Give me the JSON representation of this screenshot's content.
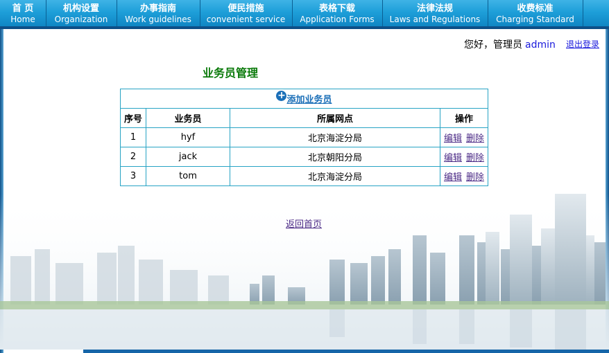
{
  "nav": [
    {
      "zh": "首 页",
      "en": "Home"
    },
    {
      "zh": "机构设置",
      "en": "Organization"
    },
    {
      "zh": "办事指南",
      "en": "Work guidelines"
    },
    {
      "zh": "便民措施",
      "en": "convenient service"
    },
    {
      "zh": "表格下载",
      "en": "Application Forms"
    },
    {
      "zh": "法律法规",
      "en": "Laws and Regulations"
    },
    {
      "zh": "收费标准",
      "en": "Charging Standard"
    }
  ],
  "header": {
    "greeting": "您好，管理员",
    "username": "admin",
    "logout": "退出登录"
  },
  "page_title": "业务员管理",
  "table": {
    "add_label": "添加业务员",
    "columns": [
      "序号",
      "业务员",
      "所属网点",
      "操作"
    ],
    "rows": [
      {
        "no": "1",
        "name": "hyf",
        "branch": "北京海淀分局"
      },
      {
        "no": "2",
        "name": "jack",
        "branch": "北京朝阳分局"
      },
      {
        "no": "3",
        "name": "tom",
        "branch": "北京海淀分局"
      }
    ],
    "edit_label": "编辑",
    "delete_label": "删除"
  },
  "back_link": "返回首页",
  "colors": {
    "nav": "#1e9fd9",
    "title": "#0a7a0a",
    "table_border": "#27a3c4",
    "link": "#4b2a86"
  }
}
